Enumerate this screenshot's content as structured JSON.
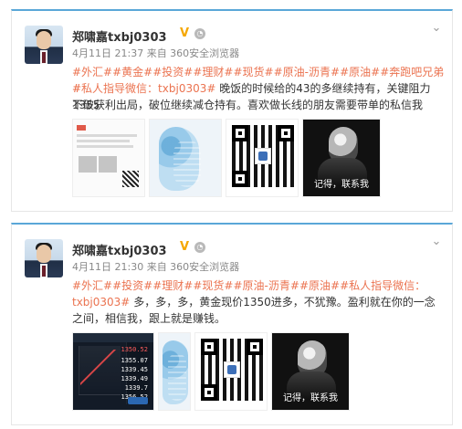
{
  "posts": [
    {
      "author": "郑啸嘉txbj0303",
      "meta": "4月11日 21:37 来自 360安全浏览器",
      "text_line_1_tags": [
        "#外汇#",
        "#黄金#",
        "#投资#",
        "#理财#",
        "#现货#",
        "#原油-沥青#",
        "#原油#",
        "#奔跑吧兄弟#",
        "#私人指导微信：txbj0303#"
      ],
      "text_line_2_tag": "#私人指导微信：txbj0303#",
      "text_line_2_rest": "晚饭的时候给的43的多继续持有，关键阻力1355",
      "text_line_3": "不破获利出局，破位继续减仓持有。喜欢做长线的朋友需要带单的私信我",
      "poster_caption": "记得，联系我"
    },
    {
      "author": "郑啸嘉txbj0303",
      "meta": "4月11日 21:30 来自 360安全浏览器",
      "tags_line_1": [
        "#外汇#",
        "#投资#",
        "#理财#",
        "#现货#",
        "#原油-沥青#",
        "#原油#",
        "#私人指导微信："
      ],
      "tags_line_2": "txbj0303#",
      "text_line_2_rest": "多，多，多，黄金现价1350进多，不犹豫。盈利就在你的一念",
      "text_line_3": "之间，相信我，跟上就是赚钱。",
      "poster_caption": "记得，联系我",
      "trade_prices": [
        "1350.52",
        "1355.07",
        "1339.45",
        "1339.49",
        "1339.7",
        "1356.52"
      ]
    }
  ],
  "colors": {
    "tag": "#eb7350",
    "card_accent": "#5aa7d8"
  },
  "icons": {
    "verify": "verified-v-icon",
    "vip": "vip-icon",
    "chevron": "chevron-down-icon"
  }
}
